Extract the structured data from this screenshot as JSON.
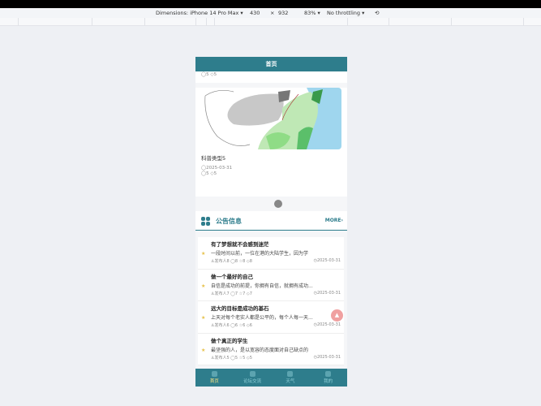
{
  "devtools": {
    "dimensions": "Dimensions: iPhone 14 Pro Max ▾",
    "width": "430",
    "x": "×",
    "height": "932",
    "zoom": "83% ▾",
    "throttle": "No throttling ▾"
  },
  "header": {
    "title": "首页"
  },
  "prev_card": {
    "meta": "◯5 ◇5"
  },
  "news_card": {
    "title": "科普类型5",
    "date": "◯2025-03-31",
    "meta": "◯5 ◇5"
  },
  "announcements": {
    "title": "公告信息",
    "more": "MORE›",
    "items": [
      {
        "title": "有了梦想就不会感到迷茫",
        "body": "一段时间以前，一位在港的大陆学生，因为学",
        "author": "♙发布人8",
        "likes": "◯8",
        "stars": "☆8",
        "views": "◇8",
        "date": "◷2025-03-31"
      },
      {
        "title": "做一个最好的自己",
        "body": "自信是成功的前提，你拥有自信，就拥有成功...",
        "author": "♙发布人7",
        "likes": "◯7",
        "stars": "☆7",
        "views": "◇7",
        "date": "◷2025-03-31"
      },
      {
        "title": "远大的目标是成功的基石",
        "body": "上天对每个老实人都是公平的，每个人每一天...",
        "author": "♙发布人6",
        "likes": "◯6",
        "stars": "☆6",
        "views": "◇6",
        "date": "◷2025-03-31"
      },
      {
        "title": "做个真正的学生",
        "body": "最坚强的人，是以宽容的态度面对自己缺点的",
        "author": "♙发布人5",
        "likes": "◯5",
        "stars": "☆5",
        "views": "◇5",
        "date": "◷2025-03-31"
      }
    ]
  },
  "tabs": [
    {
      "label": "首页"
    },
    {
      "label": "论坛交流"
    },
    {
      "label": "天气"
    },
    {
      "label": "我的"
    }
  ]
}
